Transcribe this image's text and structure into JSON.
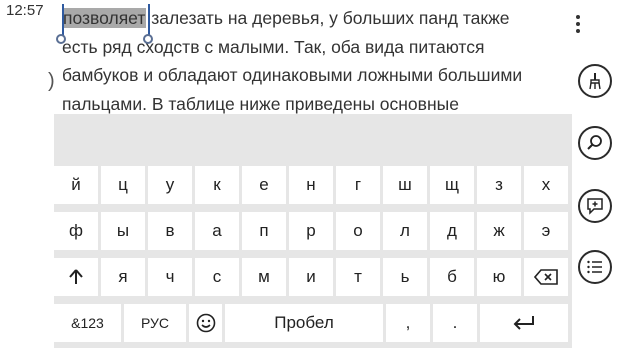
{
  "status": {
    "time": "12:57"
  },
  "document": {
    "selected_word": "позволяет",
    "line1_rest": " залезать на деревья, у больших панд также",
    "line2": "есть ряд сходств с малыми. Так, оба вида питаются",
    "line3": "бамбуков и обладают одинаковыми ложными большими",
    "line4": "пальцами. В таблице ниже приведены основные",
    "paren": ")"
  },
  "keyboard": {
    "row1": [
      "й",
      "ц",
      "у",
      "к",
      "е",
      "н",
      "г",
      "ш",
      "щ",
      "з",
      "х"
    ],
    "row2": [
      "ф",
      "ы",
      "в",
      "а",
      "п",
      "р",
      "о",
      "л",
      "д",
      "ж",
      "э"
    ],
    "row3": [
      "я",
      "ч",
      "с",
      "м",
      "и",
      "т",
      "ь",
      "б",
      "ю"
    ],
    "symbols_label": "&123",
    "language_label": "РУС",
    "space_label": "Пробел",
    "comma": ",",
    "period": ".",
    "icons": {
      "shift": "shift-arrow-up-icon",
      "backspace": "backspace-icon",
      "emoji": "emoji-smiley-icon",
      "enter": "enter-return-icon"
    }
  },
  "app_bar": {
    "icons": [
      "more-dots-icon",
      "format-brush-icon",
      "find-icon",
      "add-comment-icon",
      "list-icon"
    ]
  }
}
